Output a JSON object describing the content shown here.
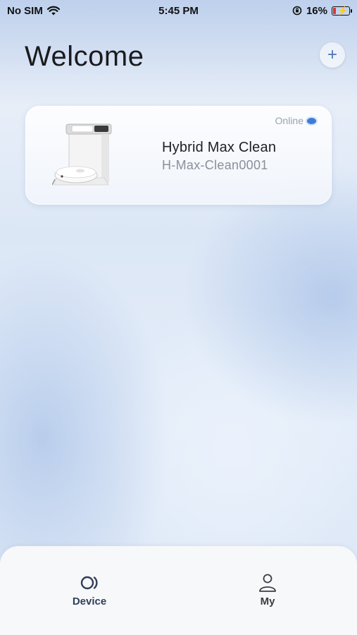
{
  "status_bar": {
    "carrier": "No SIM",
    "time": "5:45 PM",
    "battery": "16%"
  },
  "header": {
    "title": "Welcome",
    "add_label": "+"
  },
  "devices": [
    {
      "name": "Hybrid Max Clean",
      "id": "H-Max-Clean0001",
      "status": "Online",
      "status_color": "#3d7bd8"
    }
  ],
  "tab_bar": {
    "tabs": [
      {
        "label": "Device",
        "icon": "device-icon",
        "active": true
      },
      {
        "label": "My",
        "icon": "person-icon",
        "active": false
      }
    ]
  },
  "colors": {
    "accent": "#4f73b4",
    "battery_low": "#e0322e"
  }
}
